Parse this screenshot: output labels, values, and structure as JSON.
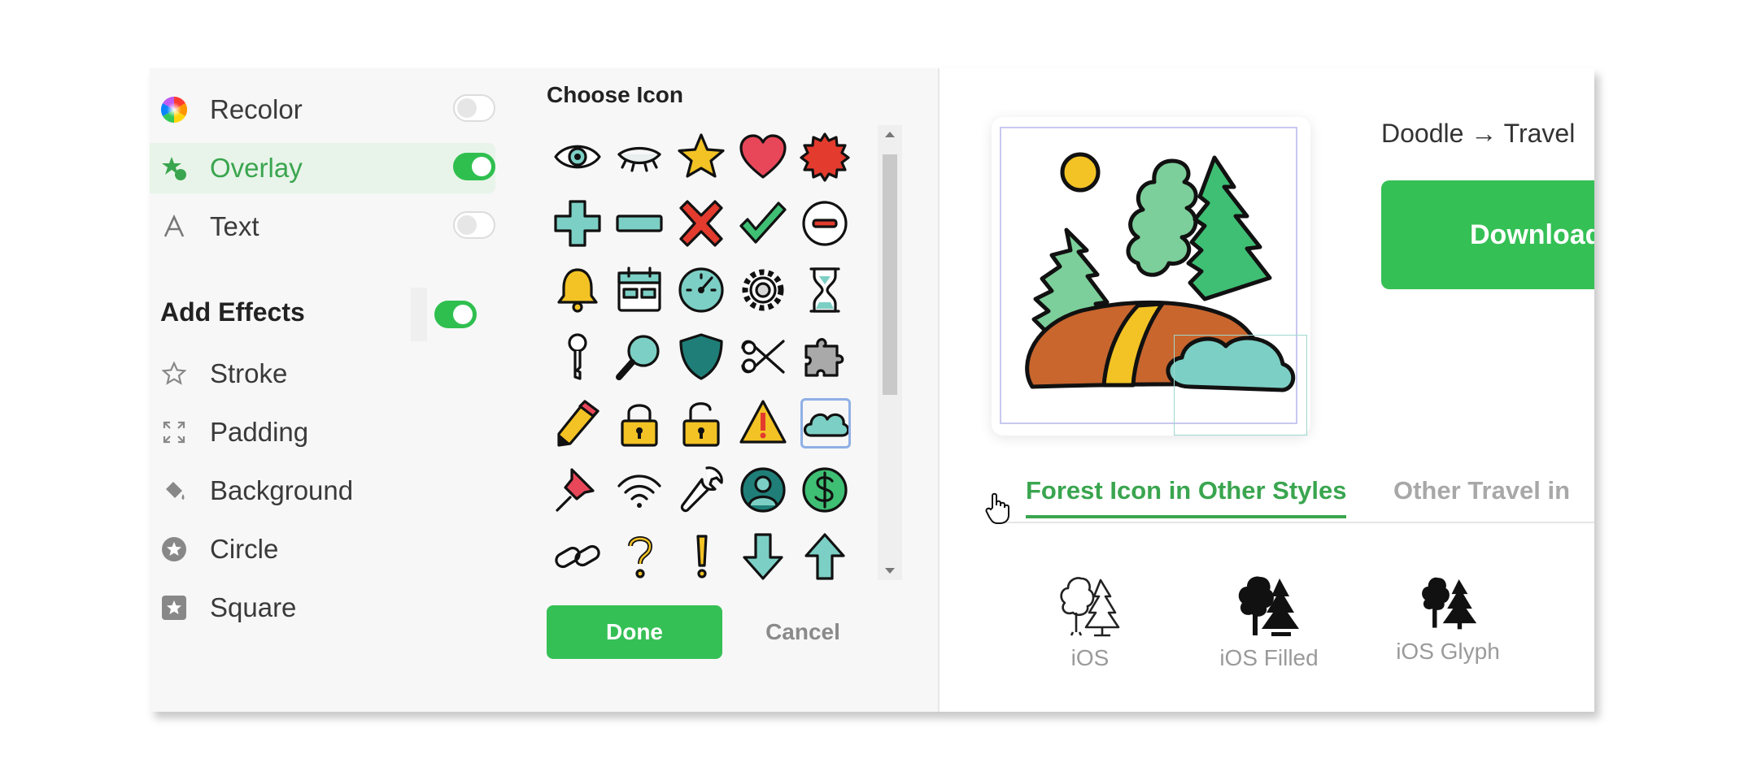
{
  "left_panel": {
    "options": [
      {
        "label": "Recolor",
        "toggle_on": false
      },
      {
        "label": "Overlay",
        "toggle_on": true,
        "active": true
      },
      {
        "label": "Text",
        "toggle_on": false
      }
    ],
    "effects_heading": "Add Effects",
    "effects_toggle_on": true,
    "effects": [
      {
        "label": "Stroke",
        "icon": "star-outline-icon"
      },
      {
        "label": "Padding",
        "icon": "expand-icon"
      },
      {
        "label": "Background",
        "icon": "paint-bucket-icon"
      },
      {
        "label": "Circle",
        "icon": "star-circle-icon"
      },
      {
        "label": "Square",
        "icon": "star-square-icon"
      }
    ]
  },
  "icon_chooser": {
    "title": "Choose Icon",
    "icons": [
      "eye",
      "closed-eye",
      "star",
      "heart",
      "badge",
      "plus",
      "minus",
      "cross",
      "checkmark",
      "minus-circle",
      "bell",
      "calendar",
      "speedometer",
      "gear",
      "hourglass",
      "key",
      "magnifier",
      "shield",
      "scissors",
      "puzzle",
      "pencil",
      "lock",
      "unlock",
      "warning",
      "cloud",
      "pin",
      "wifi",
      "wrench",
      "user-circle",
      "dollar-coin",
      "link",
      "question",
      "exclamation",
      "arrow-down",
      "arrow-up"
    ],
    "selected_icon": "cloud",
    "done_label": "Done",
    "cancel_label": "Cancel"
  },
  "preview": {
    "breadcrumb": "Doodle → Travel",
    "download_label": "Download"
  },
  "tabs": [
    {
      "label": "Forest Icon in Other Styles",
      "active": true
    },
    {
      "label": "Other Travel in",
      "active": false
    }
  ],
  "styles": [
    {
      "label": "iOS"
    },
    {
      "label": "iOS Filled"
    },
    {
      "label": "iOS Glyph"
    }
  ],
  "colors": {
    "accent_green": "#35c055",
    "active_bg": "#e8f4e9",
    "teal": "#7ccfc4",
    "yellow": "#f3c325",
    "red": "#d93b3b",
    "brown": "#c8662e"
  }
}
